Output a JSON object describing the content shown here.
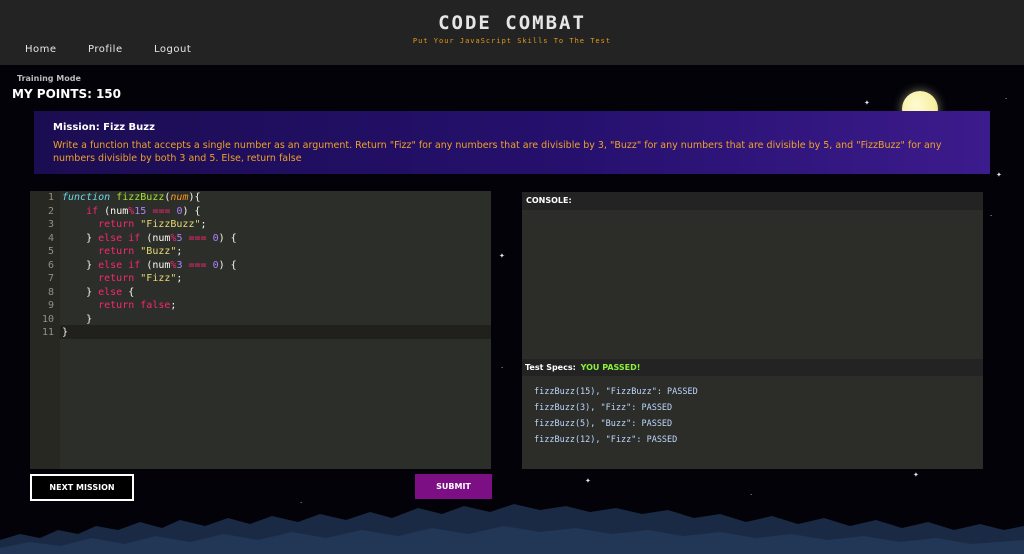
{
  "header": {
    "logo": "CODE COMBAT",
    "tagline": "Put Your JavaScript Skills To The Test",
    "nav": [
      {
        "label": "Home"
      },
      {
        "label": "Profile"
      },
      {
        "label": "Logout"
      }
    ]
  },
  "status": {
    "mode": "Training Mode",
    "points_label": "MY POINTS:",
    "points_value": "150"
  },
  "mission": {
    "title": "Mission: Fizz Buzz",
    "description": "Write a function that accepts a single number as an argument. Return \"Fizz\" for any numbers that are divisible by 3, \"Buzz\" for any numbers that are divisible by 5, and \"FizzBuzz\" for any numbers divisible by both 3 and 5. Else, return false"
  },
  "editor": {
    "line_numbers": [
      "1",
      "2",
      "3",
      "4",
      "5",
      "6",
      "7",
      "8",
      "9",
      "10",
      "11"
    ],
    "lines": [
      "function fizzBuzz(num){",
      "    if (num%15 === 0) {",
      "      return \"FizzBuzz\";",
      "    } else if (num%5 === 0) {",
      "      return \"Buzz\";",
      "    } else if (num%3 === 0) {",
      "      return \"Fizz\";",
      "    } else {",
      "      return false;",
      "    }",
      "}"
    ]
  },
  "console": {
    "label": "CONSOLE:",
    "specs_label": "Test Specs:",
    "specs_status": "YOU PASSED!",
    "specs": [
      "fizzBuzz(15), \"FizzBuzz\": PASSED",
      "fizzBuzz(3), \"Fizz\": PASSED",
      "fizzBuzz(5), \"Buzz\": PASSED",
      "fizzBuzz(12), \"Fizz\": PASSED"
    ]
  },
  "buttons": {
    "next_label": "NEXT MISSION",
    "submit_label": "SUBMIT"
  },
  "colors": {
    "accent_orange": "#f0a228",
    "submit_purple": "#7d0f84",
    "pass_green": "#8bf13c",
    "mission_bg": "#25106d"
  }
}
